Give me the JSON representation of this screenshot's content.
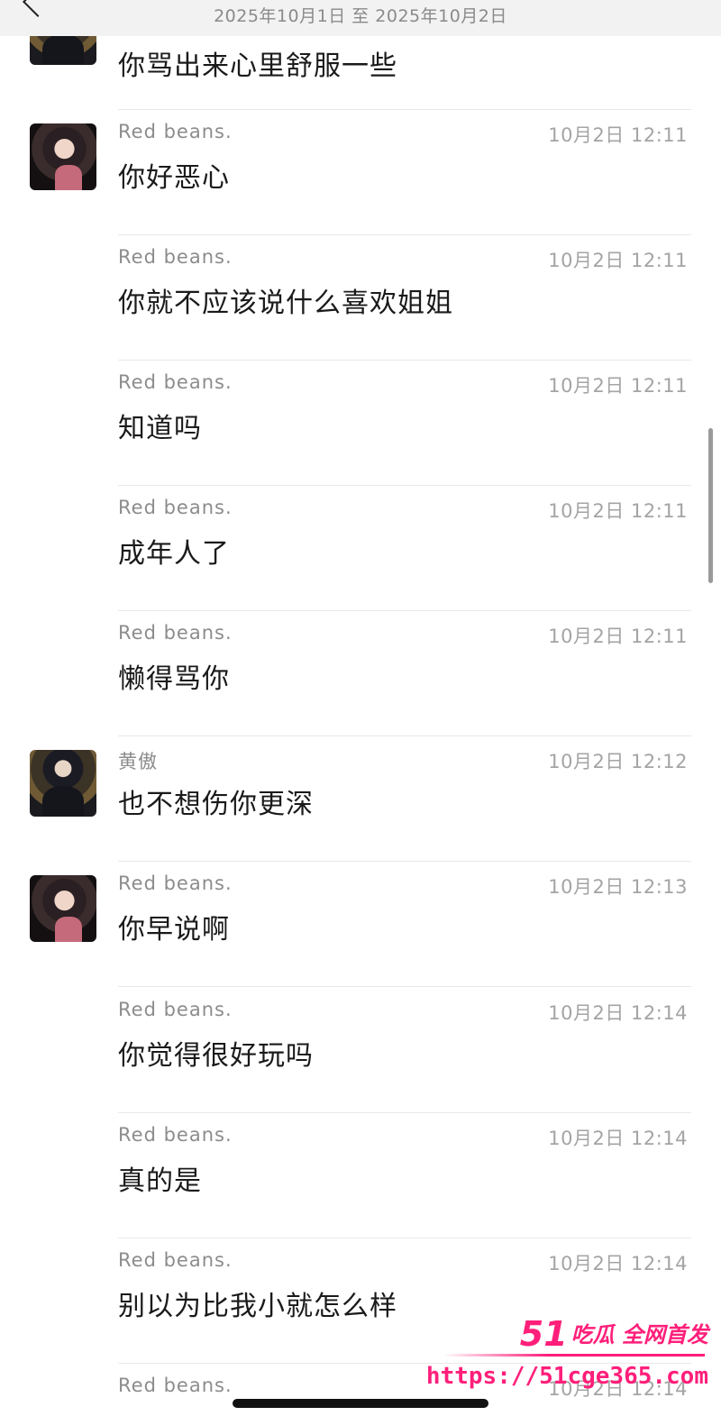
{
  "header": {
    "date_range": "2025年10月1日 至 2025年10月2日"
  },
  "first_message_text": "你骂出来心里舒服一些",
  "messages": [
    {
      "sender": "Red  beans.",
      "time": "10月2日 12:11",
      "text": "你好恶心",
      "avatar": "her"
    },
    {
      "sender": "Red  beans.",
      "time": "10月2日 12:11",
      "text": "你就不应该说什么喜欢姐姐",
      "avatar": ""
    },
    {
      "sender": "Red  beans.",
      "time": "10月2日 12:11",
      "text": "知道吗",
      "avatar": ""
    },
    {
      "sender": "Red  beans.",
      "time": "10月2日 12:11",
      "text": "成年人了",
      "avatar": ""
    },
    {
      "sender": "Red  beans.",
      "time": "10月2日 12:11",
      "text": "懒得骂你",
      "avatar": ""
    },
    {
      "sender": "黄傲",
      "time": "10月2日 12:12",
      "text": "也不想伤你更深",
      "avatar": "him"
    },
    {
      "sender": "Red  beans.",
      "time": "10月2日 12:13",
      "text": "你早说啊",
      "avatar": "her"
    },
    {
      "sender": "Red  beans.",
      "time": "10月2日 12:14",
      "text": "你觉得很好玩吗",
      "avatar": ""
    },
    {
      "sender": "Red  beans.",
      "time": "10月2日 12:14",
      "text": "真的是",
      "avatar": ""
    },
    {
      "sender": "Red  beans.",
      "time": "10月2日 12:14",
      "text": "别以为比我小就怎么样",
      "avatar": ""
    },
    {
      "sender": "Red  beans.",
      "time": "10月2日 12:14",
      "text": "",
      "avatar": ""
    }
  ],
  "watermark": {
    "number": "51",
    "tagline": "吃瓜 全网首发",
    "url": "https://51cge365.com"
  },
  "icons": {
    "back": "back-chevron-icon"
  }
}
